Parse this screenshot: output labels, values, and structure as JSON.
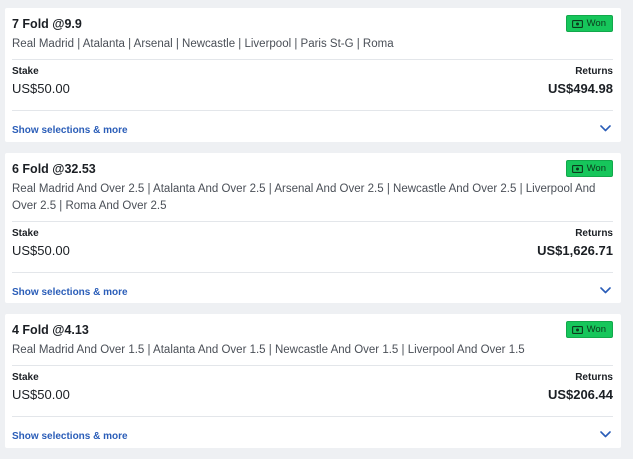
{
  "bets": [
    {
      "title": "7 Fold @9.9",
      "status": "Won",
      "selections": "Real Madrid | Atalanta | Arsenal | Newcastle | Liverpool | Paris St-G | Roma",
      "stake_label": "Stake",
      "stake": "US$50.00",
      "returns_label": "Returns",
      "returns": "US$494.98",
      "show_more": "Show selections & more"
    },
    {
      "title": "6 Fold @32.53",
      "status": "Won",
      "selections": "Real Madrid And Over 2.5 | Atalanta And Over 2.5 | Arsenal And Over 2.5 | Newcastle And Over 2.5 | Liverpool And Over 2.5 | Roma And Over 2.5",
      "stake_label": "Stake",
      "stake": "US$50.00",
      "returns_label": "Returns",
      "returns": "US$1,626.71",
      "show_more": "Show selections & more"
    },
    {
      "title": "4 Fold @4.13",
      "status": "Won",
      "selections": "Real Madrid And Over 1.5 | Atalanta And Over 1.5 | Newcastle And Over 1.5 | Liverpool And Over 1.5",
      "stake_label": "Stake",
      "stake": "US$50.00",
      "returns_label": "Returns",
      "returns": "US$206.44",
      "show_more": "Show selections & more"
    }
  ],
  "icons": {
    "badge": "cash-icon",
    "expand": "chevron-down-icon"
  },
  "colors": {
    "won_badge": "#16c65b",
    "link": "#2a5db8",
    "background": "#eef0f3"
  }
}
